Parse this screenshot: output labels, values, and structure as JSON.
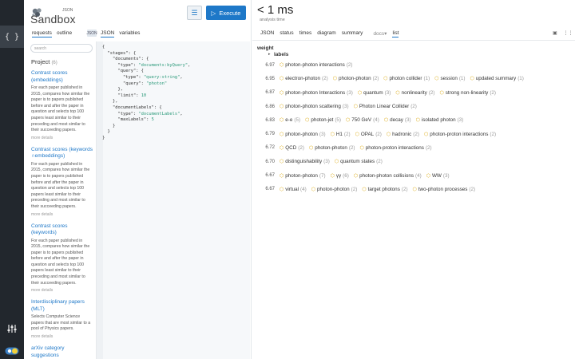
{
  "brand": {
    "name": "Sandbox",
    "sup": "JSON"
  },
  "toolbar": {
    "execute_label": "Execute"
  },
  "left_tabs": {
    "requests": "requests",
    "outline": "outline",
    "json_tag": "JSON",
    "json": "JSON",
    "variables": "variables"
  },
  "sidebar": {
    "search_placeholder": "search",
    "project_label": "Project",
    "project_count": "(6)",
    "entries": [
      {
        "title": "Contrast scores (embeddings)",
        "desc": "For each paper published in 2015, compares how similar the paper is to papers published before and after the paper in question and selects top 100 papers least similar to their preceding and most similar to their succeeding papers.",
        "more": "more details"
      },
      {
        "title": "Contrast scores (keywords ∩embeddings)",
        "desc": "For each paper published in 2015, compares how similar the paper is to papers published before and after the paper in question and selects top 100 papers least similar to their preceding and most similar to their succeeding papers.",
        "more": "more details"
      },
      {
        "title": "Contrast scores (keywords)",
        "desc": "For each paper published in 2015, compares how similar the paper is to papers published before and after the paper in question and selects top 100 papers least similar to their preceding and most similar to their succeeding papers.",
        "more": "more details"
      },
      {
        "title": "Interdisciplinary papers (MLT)",
        "desc": "Selects Computer Science papers that are most similar to a pool of Physics papers.",
        "more": "more details"
      },
      {
        "title": "arXiv category suggestions",
        "desc": "",
        "more": ""
      }
    ]
  },
  "result": {
    "time": "< 1 ms",
    "time_sub": "analysis time",
    "tabs": [
      "JSON",
      "status",
      "times",
      "diagram",
      "summary"
    ],
    "sub_tab_docs": "docs",
    "sub_tab_list": "list",
    "weight_header": "weight",
    "labels_header": "labels",
    "rows": [
      {
        "weight": "6.97",
        "labels": [
          {
            "t": "photon-photon interactions",
            "c": "(2)"
          }
        ]
      },
      {
        "weight": "6.95",
        "labels": [
          {
            "t": "electron-photon",
            "c": "(2)"
          },
          {
            "t": "photon-photon",
            "c": "(2)"
          },
          {
            "t": "photon collider",
            "c": "(1)"
          },
          {
            "t": "session",
            "c": "(1)"
          },
          {
            "t": "updated summary",
            "c": "(1)"
          }
        ]
      },
      {
        "weight": "6.87",
        "labels": [
          {
            "t": "photon-photon Interactions",
            "c": "(3)"
          },
          {
            "t": "quantum",
            "c": "(3)"
          },
          {
            "t": "nonlinearity",
            "c": "(2)"
          },
          {
            "t": "strong non-linearity",
            "c": "(2)"
          }
        ]
      },
      {
        "weight": "6.86",
        "labels": [
          {
            "t": "photon-photon scattering",
            "c": "(3)"
          },
          {
            "t": "Photon Linear Collider",
            "c": "(2)"
          }
        ]
      },
      {
        "weight": "6.83",
        "labels": [
          {
            "t": "e-e",
            "c": "(5)"
          },
          {
            "t": "photon-jet",
            "c": "(5)"
          },
          {
            "t": "750 GeV",
            "c": "(4)"
          },
          {
            "t": "decay",
            "c": "(3)"
          },
          {
            "t": "isolated photon",
            "c": "(3)"
          }
        ]
      },
      {
        "weight": "6.79",
        "labels": [
          {
            "t": "photon-photon",
            "c": "(3)"
          },
          {
            "t": "H1",
            "c": "(2)"
          },
          {
            "t": "OPAL",
            "c": "(2)"
          },
          {
            "t": "hadronic",
            "c": "(2)"
          },
          {
            "t": "photon-proton interactions",
            "c": "(2)"
          }
        ]
      },
      {
        "weight": "6.72",
        "labels": [
          {
            "t": "QCD",
            "c": "(2)"
          },
          {
            "t": "photon-photon",
            "c": "(2)"
          },
          {
            "t": "photon-proton interactions",
            "c": "(2)"
          }
        ]
      },
      {
        "weight": "6.70",
        "labels": [
          {
            "t": "distinguishability",
            "c": "(3)"
          },
          {
            "t": "quantum states",
            "c": "(2)"
          }
        ]
      },
      {
        "weight": "6.67",
        "labels": [
          {
            "t": "photon-photon",
            "c": "(7)"
          },
          {
            "t": "γγ",
            "c": "(6)"
          },
          {
            "t": "photon-photon collisions",
            "c": "(4)"
          },
          {
            "t": "WW",
            "c": "(3)"
          }
        ]
      },
      {
        "weight": "6.67",
        "labels": [
          {
            "t": "virtual",
            "c": "(4)"
          },
          {
            "t": "photon-photon",
            "c": "(2)"
          },
          {
            "t": "target photons",
            "c": "(2)"
          },
          {
            "t": "two-photon processes",
            "c": "(2)"
          }
        ]
      }
    ]
  },
  "colors": {
    "accent": "#1e78c8",
    "rail": "#22272d",
    "tag": "#d9a400"
  }
}
